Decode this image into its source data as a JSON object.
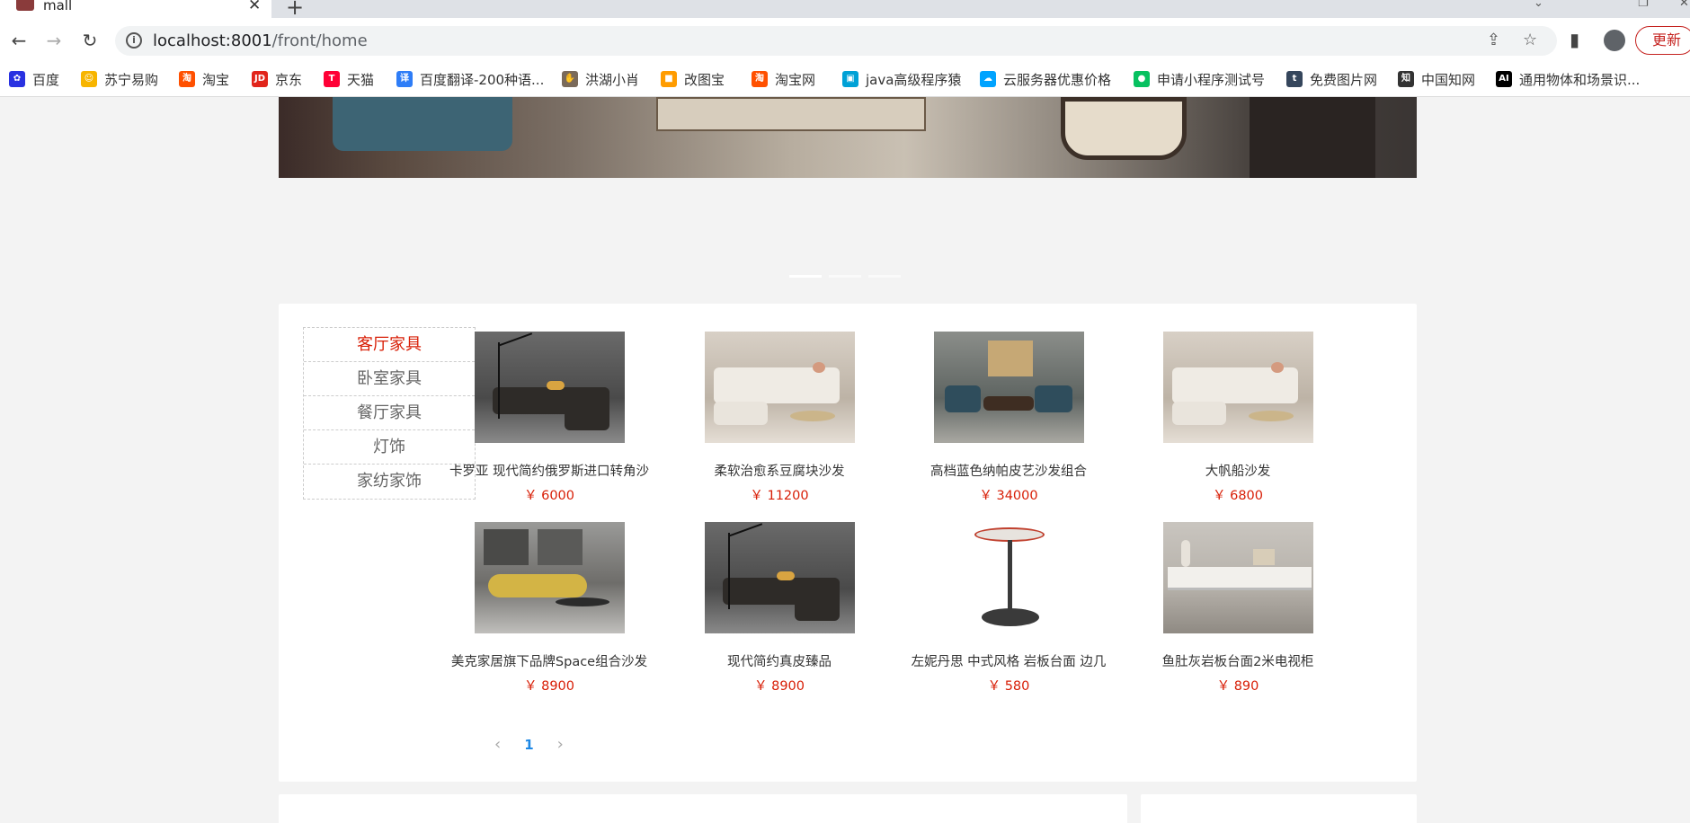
{
  "browser": {
    "tab_title": "mall",
    "url_host": "localhost:8001",
    "url_path": "/front/home",
    "update_label": "更新"
  },
  "bookmarks": [
    {
      "label": "百度",
      "icon": "baidu-icon",
      "color": "#2932e1"
    },
    {
      "label": "苏宁易购",
      "icon": "suning-icon",
      "color": "#f7b500"
    },
    {
      "label": "淘宝",
      "icon": "taobao-icon",
      "color": "#ff5000"
    },
    {
      "label": "京东",
      "icon": "jd-icon",
      "color": "#e1251b"
    },
    {
      "label": "天猫",
      "icon": "tmall-icon",
      "color": "#ff0036"
    },
    {
      "label": "百度翻译-200种语...",
      "icon": "translate-icon",
      "color": "#2e7df7"
    },
    {
      "label": "洪湖小肖",
      "icon": "hand-icon",
      "color": "#7a6a5a"
    },
    {
      "label": "改图宝",
      "icon": "gaitubao-icon",
      "color": "#ff9c00"
    },
    {
      "label": "淘宝网",
      "icon": "taobao-icon",
      "color": "#ff5000"
    },
    {
      "label": "java高级程序猿",
      "icon": "bilibili-icon",
      "color": "#00a1d6"
    },
    {
      "label": "云服务器优惠价格",
      "icon": "cloud-icon",
      "color": "#00a3ff"
    },
    {
      "label": "申请小程序测试号",
      "icon": "wechat-icon",
      "color": "#07c160"
    },
    {
      "label": "免费图片网",
      "icon": "tumblr-icon",
      "color": "#35465c"
    },
    {
      "label": "中国知网",
      "icon": "cnki-icon",
      "color": "#333333"
    },
    {
      "label": "通用物体和场景识...",
      "icon": "ai-icon",
      "color": "#000000"
    }
  ],
  "categories": [
    {
      "label": "客厅家具",
      "active": true
    },
    {
      "label": "卧室家具",
      "active": false
    },
    {
      "label": "餐厅家具",
      "active": false
    },
    {
      "label": "灯饰",
      "active": false
    },
    {
      "label": "家纺家饰",
      "active": false
    }
  ],
  "products": [
    {
      "name": "卡罗亚 现代简约俄罗斯进口转角沙",
      "price": "￥ 6000"
    },
    {
      "name": "柔软治愈系豆腐块沙发",
      "price": "￥ 11200"
    },
    {
      "name": "高档蓝色纳帕皮艺沙发组合",
      "price": "￥ 34000"
    },
    {
      "name": "大帆船沙发",
      "price": "￥ 6800"
    },
    {
      "name": "美克家居旗下品牌Space组合沙发",
      "price": "￥ 8900"
    },
    {
      "name": "现代简约真皮臻品",
      "price": "￥ 8900"
    },
    {
      "name": "左妮丹思 中式风格 岩板台面 边几",
      "price": "￥ 580"
    },
    {
      "name": "鱼肚灰岩板台面2米电视柜",
      "price": "￥ 890"
    }
  ],
  "pagination": {
    "current": "1",
    "prev_icon": "chevron-left-icon",
    "next_icon": "chevron-right-icon"
  },
  "colors": {
    "accent": "#d81e06",
    "page_link": "#1e88e5"
  }
}
